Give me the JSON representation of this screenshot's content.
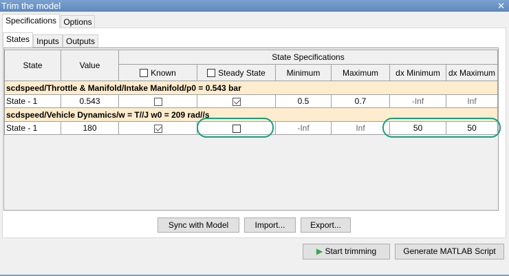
{
  "window": {
    "title": "Trim the model",
    "close_icon": "close-icon"
  },
  "tabs": [
    "Specifications",
    "Options"
  ],
  "subtabs": [
    "States",
    "Inputs",
    "Outputs"
  ],
  "table": {
    "headers": {
      "state": "State",
      "value": "Value",
      "group": "State Specifications",
      "known": "Known",
      "steady": "Steady State",
      "min": "Minimum",
      "max": "Maximum",
      "dxmin": "dx Minimum",
      "dxmax": "dx Maximum"
    },
    "groups": [
      {
        "label": "scdspeed/Throttle & Manifold/Intake Manifold/p0 = 0.543 bar",
        "row": {
          "state": "State - 1",
          "value": "0.543",
          "known": false,
          "steady": true,
          "min": "0.5",
          "max": "0.7",
          "dxmin": "-Inf",
          "dxmax": "Inf"
        }
      },
      {
        "label": "scdspeed/Vehicle Dynamics/w = T//J w0 = 209 rad//s",
        "row": {
          "state": "State - 1",
          "value": "180",
          "known": true,
          "steady": false,
          "min": "-Inf",
          "max": "Inf",
          "dxmin": "50",
          "dxmax": "50"
        }
      }
    ]
  },
  "buttons": {
    "sync": "Sync with Model",
    "import": "Import...",
    "export": "Export...",
    "start": "Start trimming",
    "generate": "Generate MATLAB Script"
  },
  "colors": {
    "highlight": "#14a083",
    "group_row": "#fdeccd"
  }
}
